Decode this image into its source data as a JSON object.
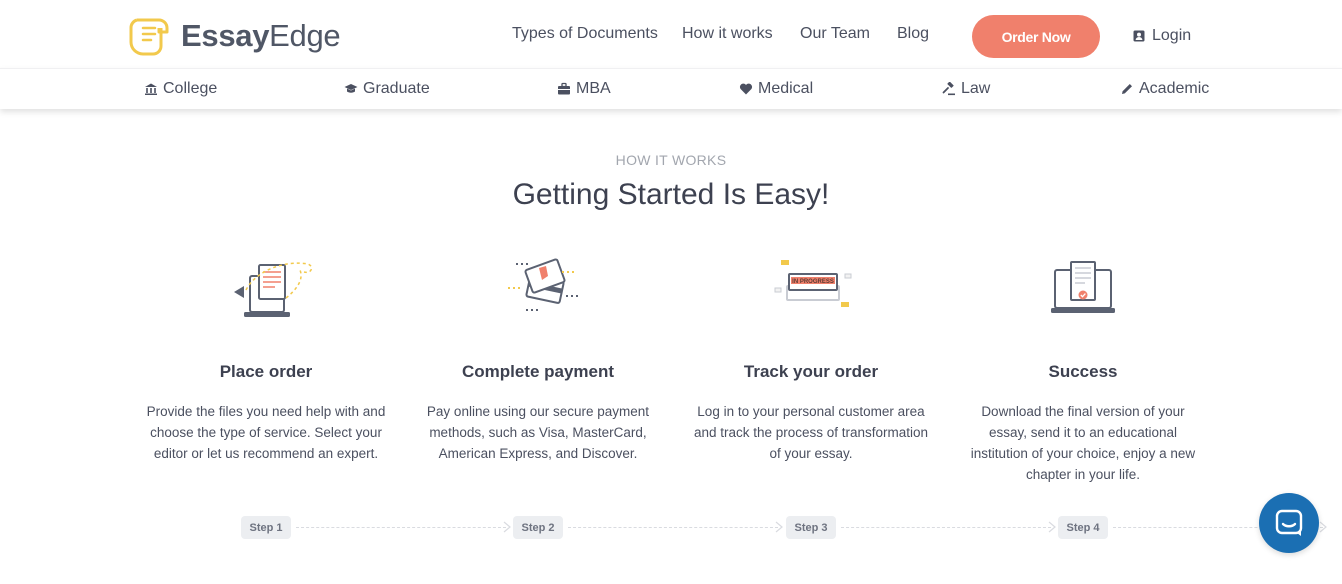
{
  "brand": {
    "name_bold": "Essay",
    "name_light": "Edge",
    "accent": "#f0806c",
    "logo_color": "#f2c94c"
  },
  "nav": [
    {
      "label": "Types of Documents"
    },
    {
      "label": "How it works"
    },
    {
      "label": "Our Team"
    },
    {
      "label": "Blog"
    }
  ],
  "order_button": "Order Now",
  "login": {
    "label": "Login",
    "icon": "user-icon"
  },
  "subnav": [
    {
      "label": "College",
      "icon": "institution-icon"
    },
    {
      "label": "Graduate",
      "icon": "graduation-cap-icon"
    },
    {
      "label": "MBA",
      "icon": "briefcase-icon"
    },
    {
      "label": "Medical",
      "icon": "heart-icon"
    },
    {
      "label": "Law",
      "icon": "gavel-icon"
    },
    {
      "label": "Academic",
      "icon": "pencil-icon"
    }
  ],
  "section": {
    "eyebrow": "HOW IT WORKS",
    "title": "Getting Started Is Easy!"
  },
  "steps": [
    {
      "title": "Place order",
      "text": "Provide the files you need help with and choose the type of service. Select your editor or let us recommend an expert.",
      "pill": "Step 1",
      "illus": "laptop-upload-illustration"
    },
    {
      "title": "Complete payment",
      "text": "Pay online using our secure payment methods, such as Visa, MasterCard, American Express, and Discover.",
      "pill": "Step 2",
      "illus": "credit-cards-illustration"
    },
    {
      "title": "Track your order",
      "text": "Log in to your personal customer area and track the process of transformation of your essay.",
      "pill": "Step 3",
      "illus": "in-progress-illustration",
      "badge": "IN PROGRESS"
    },
    {
      "title": "Success",
      "text": "Download the final version of your essay, send it to an educational institution of your choice, enjoy a new chapter in your life.",
      "pill": "Step 4",
      "illus": "laptop-document-check-illustration"
    }
  ],
  "chat": {
    "icon": "chat-bubble-icon"
  }
}
